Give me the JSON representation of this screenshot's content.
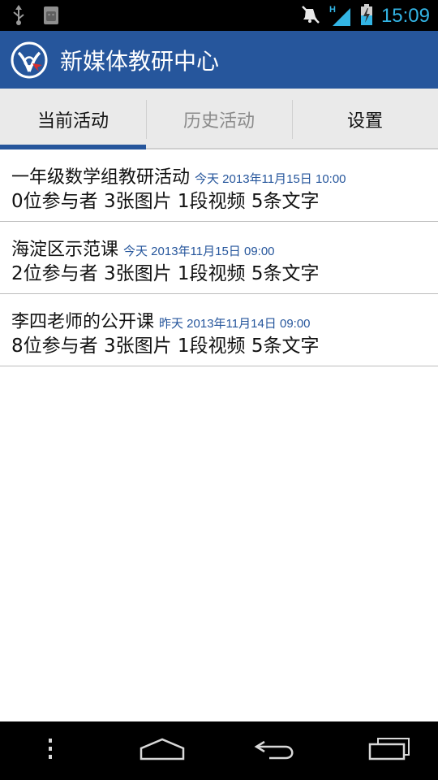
{
  "status_bar": {
    "time": "15:09",
    "network": "H",
    "icons": [
      "usb-icon",
      "android-debug-icon",
      "silent-mode-icon",
      "signal-icon",
      "battery-charging-icon"
    ]
  },
  "app": {
    "title": "新媒体教研中心",
    "logo_icon": "app-logo-icon",
    "brand_color": "#26569c"
  },
  "tabs": [
    {
      "label": "当前活动",
      "selected": true
    },
    {
      "label": "历史活动",
      "selected": false
    },
    {
      "label": "设置",
      "selected": false
    }
  ],
  "activities": [
    {
      "title": "一年级数学组教研活动",
      "meta": "今天 2013年11月15日 10:00",
      "summary": "0位参与者 3张图片 1段视频 5条文字"
    },
    {
      "title": "海淀区示范课",
      "meta": "今天 2013年11月15日 09:00",
      "summary": "2位参与者 3张图片 1段视频 5条文字"
    },
    {
      "title": "李四老师的公开课",
      "meta": "昨天 2013年11月14日 09:00",
      "summary": "8位参与者 3张图片 1段视频 5条文字"
    }
  ],
  "navigation": {
    "buttons": [
      "menu-icon",
      "home-icon",
      "back-icon",
      "recent-apps-icon"
    ]
  }
}
